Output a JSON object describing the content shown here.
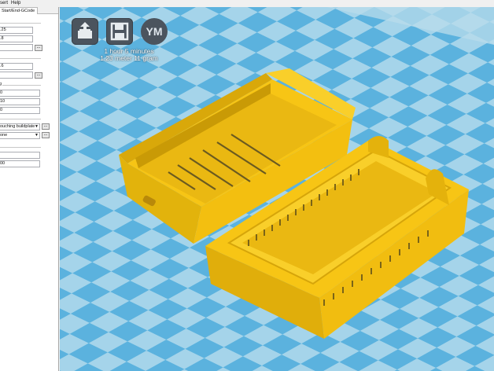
{
  "menu": {
    "items": [
      "sert",
      "Help"
    ]
  },
  "panel": {
    "tab_label": "Start/End-GCode",
    "fields": {
      "f1": ".25",
      "f2": ".8",
      "f4": ".6",
      "f6": "0",
      "f7": "10",
      "f8": "0",
      "f9": "",
      "f10": "00"
    },
    "section_label": "g",
    "support_select": "ouching buildplate",
    "adhesion_select": "one",
    "more_button": "..."
  },
  "toolbar": {
    "load_icon": "load-model-icon",
    "save_icon": "save-disk-icon",
    "ym_label": "YM"
  },
  "print_info": {
    "time": "1 hour 5 minutes",
    "material": "1.23 meter 11 gram"
  },
  "colors": {
    "floor_light": "#a5d4ea",
    "floor_dark": "#5bb2de",
    "background_sky": "#7fbcd8",
    "model": "#f7c515",
    "model_shadow": "#c99a06",
    "button_bg": "#4b545e"
  }
}
